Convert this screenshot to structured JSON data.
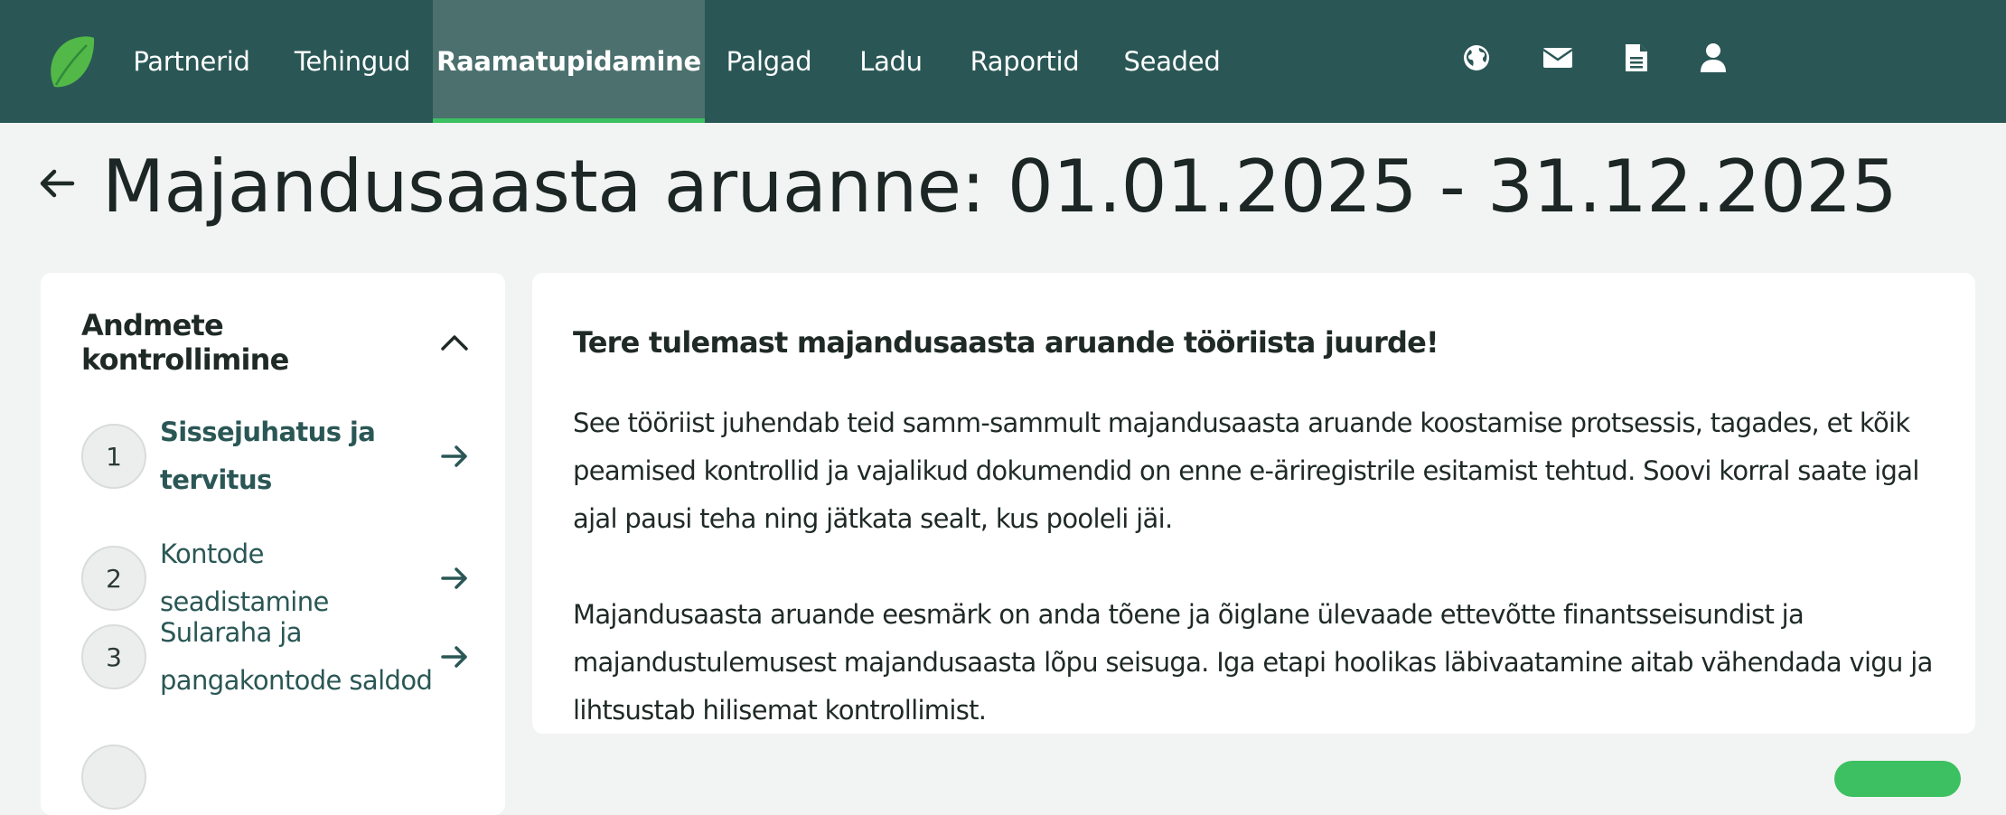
{
  "nav": {
    "items": [
      {
        "label": "Partnerid",
        "active": false
      },
      {
        "label": "Tehingud",
        "active": false
      },
      {
        "label": "Raamatupidamine",
        "active": true
      },
      {
        "label": "Palgad",
        "active": false
      },
      {
        "label": "Ladu",
        "active": false
      },
      {
        "label": "Raportid",
        "active": false
      },
      {
        "label": "Seaded",
        "active": false
      }
    ],
    "icons": [
      "globe-icon",
      "envelope-icon",
      "document-icon",
      "user-icon"
    ]
  },
  "page": {
    "title": "Majandusaasta aruanne: 01.01.2025 - 31.12.2025"
  },
  "steps_panel": {
    "title": "Andmete kontrollimine",
    "steps": [
      {
        "number": "1",
        "label": "Sissejuhatus ja tervitus",
        "current": true
      },
      {
        "number": "2",
        "label": "Kontode seadistamine",
        "current": false
      },
      {
        "number": "3",
        "label": "Sularaha ja pangakontode saldod",
        "current": false
      }
    ]
  },
  "content": {
    "heading": "Tere tulemast majandusaasta aruande tööriista juurde!",
    "paragraph1": "See tööriist juhendab teid samm-sammult majandusaasta aruande koostamise protsessis, tagades, et kõik peamised kontrollid ja vajalikud dokumendid on enne e-äriregistrile esitamist tehtud. Soovi korral saate igal ajal pausi teha ning jätkata sealt, kus pooleli jäi.",
    "paragraph2": "Majandusaasta aruande eesmärk on anda tõene ja õiglane ülevaade ettevõtte finantsseisundist ja majandustulemusest majandusaasta lõpu seisuga. Iga etapi hoolikas läbivaatamine aitab vähendada vigu ja lihtsustab hilisemat kontrollimist."
  },
  "colors": {
    "nav_bg": "#2a5755",
    "nav_active_bg": "#4b706e",
    "accent_green": "#3cc061",
    "page_bg": "#f2f4f3",
    "link_teal": "#2a5755"
  }
}
